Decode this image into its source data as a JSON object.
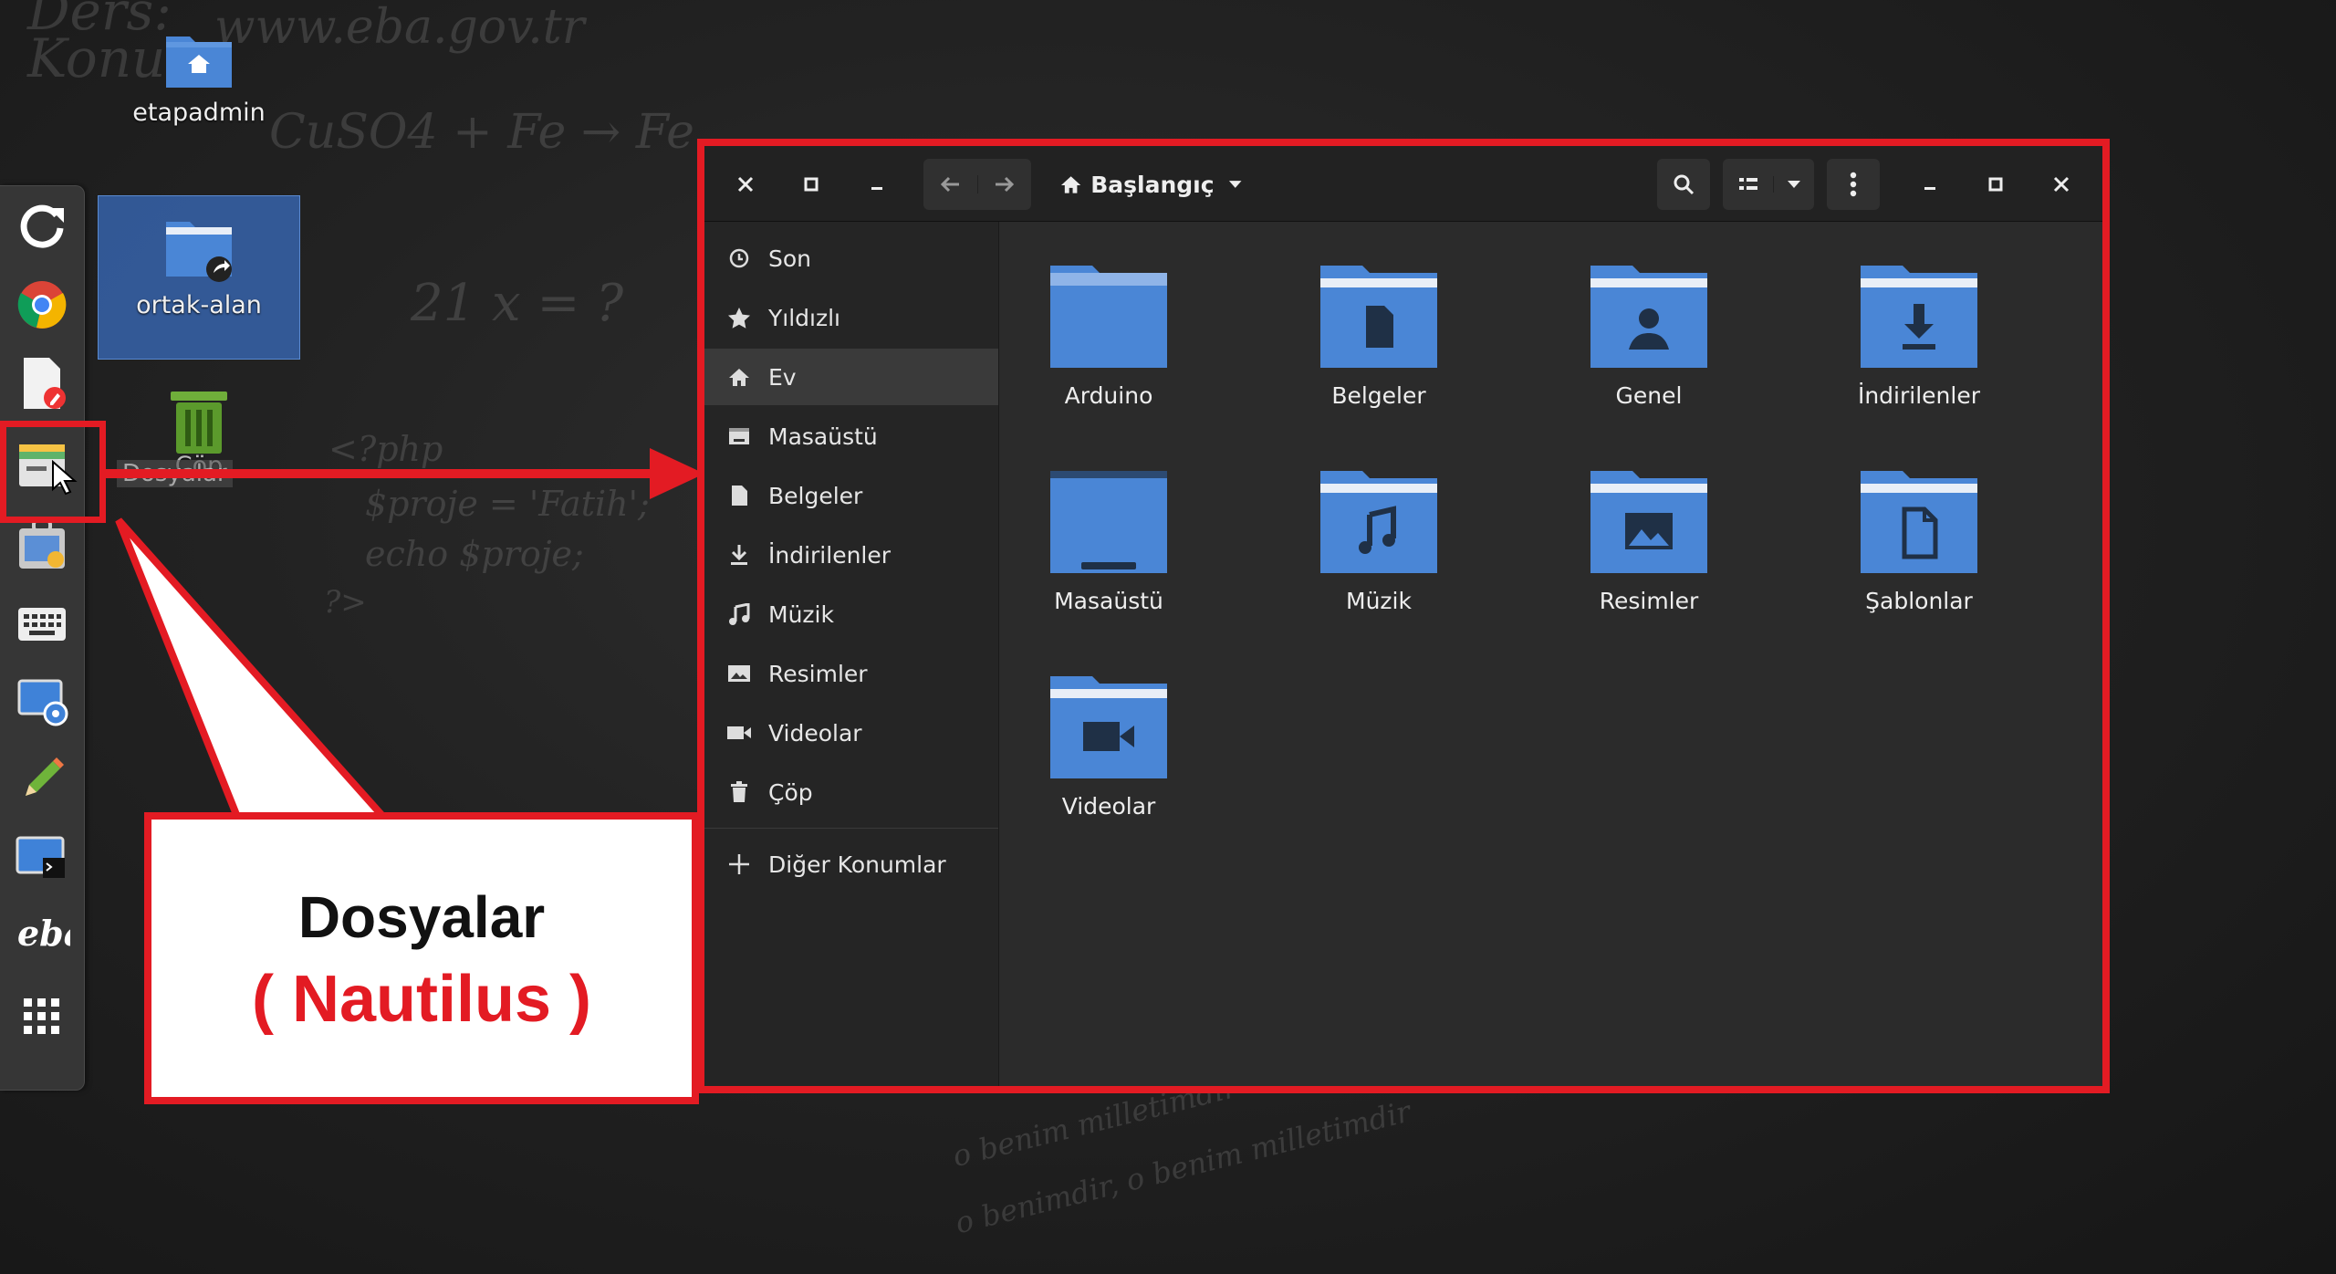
{
  "background": {
    "chalk_texts": [
      "Ders:",
      "Konu",
      "www.eba.gov.tr",
      "CuSO4 + Fe → Fe",
      "$proje = 'Fatih';",
      "echo $proje;",
      "?>",
      "<?php",
      "21 x = ?",
      "o benim milletimdir",
      "o benimdir, o benim milletimdir"
    ]
  },
  "desktop": {
    "icons": [
      {
        "label": "etapadmin",
        "type": "home-folder"
      },
      {
        "label": "ortak-alan",
        "type": "shared-folder"
      },
      {
        "label": "Çöp",
        "type": "trash"
      }
    ],
    "drag_ghost_label": "Dosyalar"
  },
  "dock": {
    "items": [
      "refresh",
      "chrome",
      "document-editor",
      "files",
      "software-center",
      "keyboard",
      "screenshot",
      "pencil",
      "terminal",
      "eba",
      "app-grid"
    ]
  },
  "window": {
    "location_label": "Başlangıç",
    "sidebar": [
      {
        "label": "Son",
        "icon": "clock-icon"
      },
      {
        "label": "Yıldızlı",
        "icon": "star-icon"
      },
      {
        "label": "Ev",
        "icon": "home-icon",
        "active": true
      },
      {
        "label": "Masaüstü",
        "icon": "desktop-icon"
      },
      {
        "label": "Belgeler",
        "icon": "document-icon"
      },
      {
        "label": "İndirilenler",
        "icon": "download-icon"
      },
      {
        "label": "Müzik",
        "icon": "music-icon"
      },
      {
        "label": "Resimler",
        "icon": "image-icon"
      },
      {
        "label": "Videolar",
        "icon": "video-icon"
      },
      {
        "label": "Çöp",
        "icon": "trash-icon"
      }
    ],
    "other_locations": "Diğer Konumlar",
    "folders": [
      {
        "label": "Arduino",
        "emblem": "none"
      },
      {
        "label": "Belgeler",
        "emblem": "document"
      },
      {
        "label": "Genel",
        "emblem": "person"
      },
      {
        "label": "İndirilenler",
        "emblem": "download"
      },
      {
        "label": "Masaüstü",
        "emblem": "desktop"
      },
      {
        "label": "Müzik",
        "emblem": "music"
      },
      {
        "label": "Resimler",
        "emblem": "image"
      },
      {
        "label": "Şablonlar",
        "emblem": "template"
      },
      {
        "label": "Videolar",
        "emblem": "video"
      }
    ]
  },
  "callout": {
    "title": "Dosyalar",
    "subtitle": "( Nautilus )"
  },
  "colors": {
    "highlight": "#e31b23",
    "folder_blue": "#4a86d6",
    "folder_top": "#e8eef7"
  }
}
